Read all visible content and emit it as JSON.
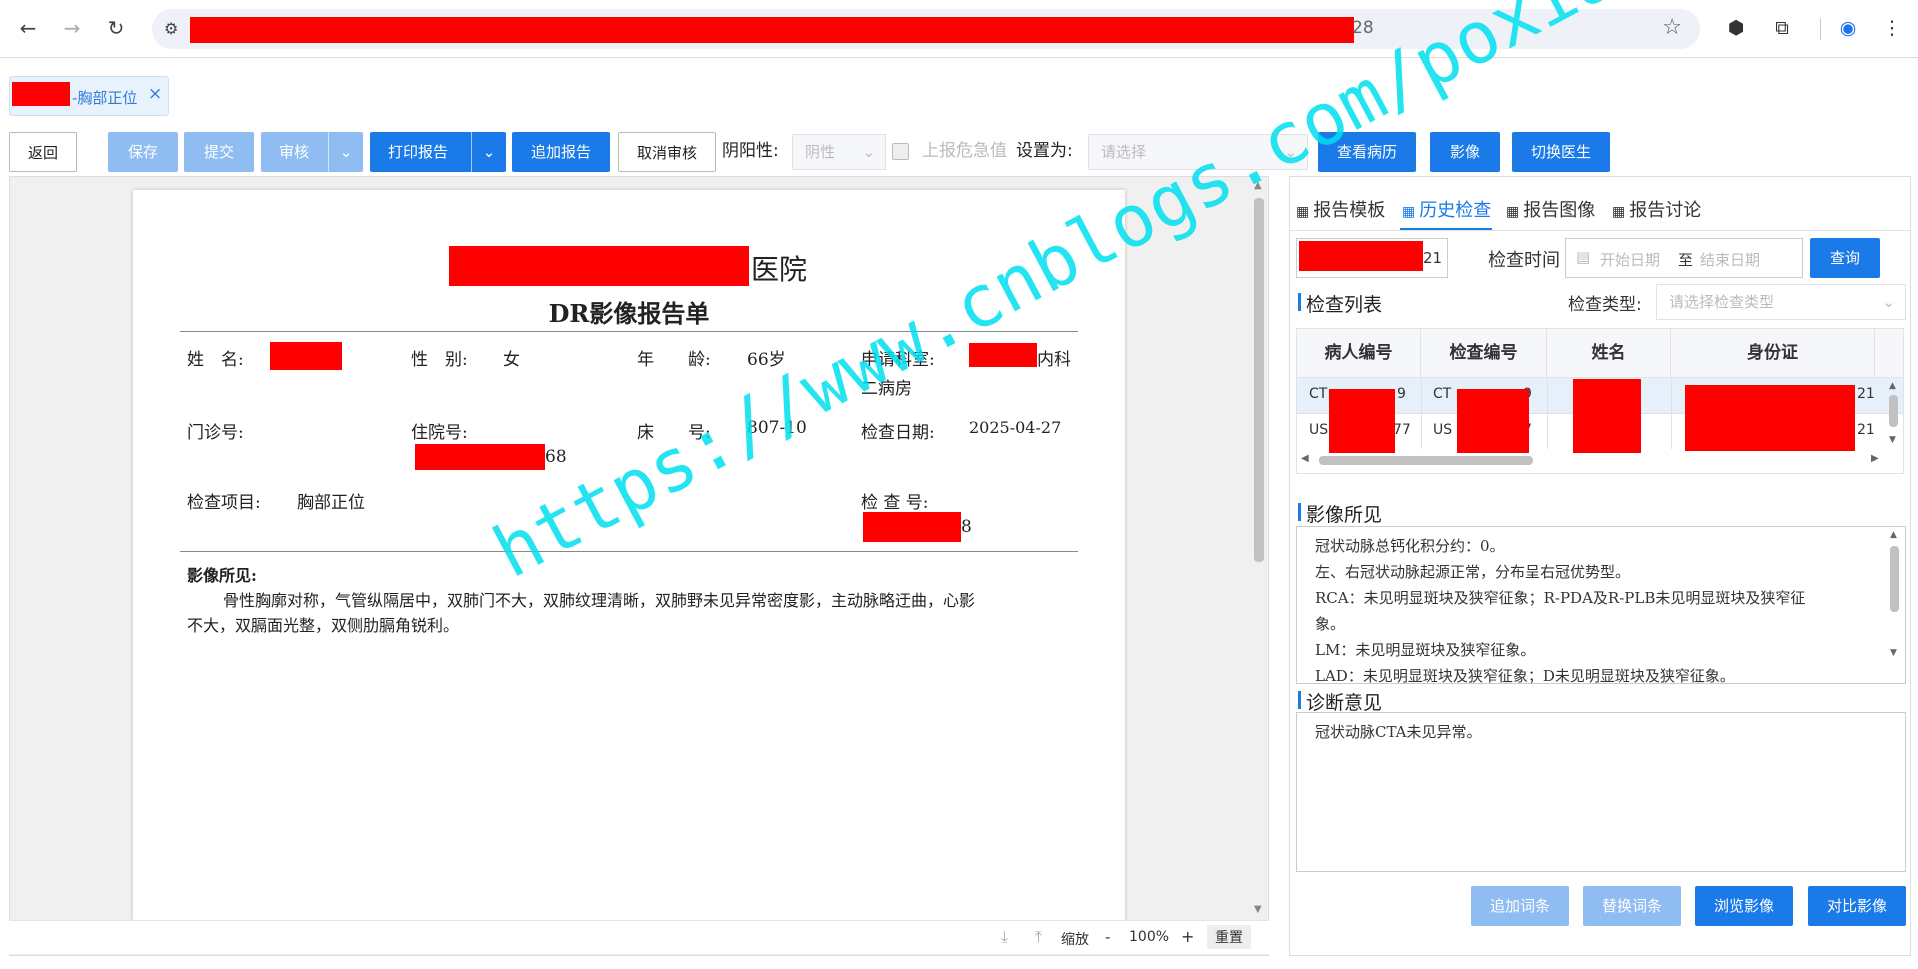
{
  "browser": {
    "url_suffix": "28",
    "icons": [
      "back-arrow-icon",
      "forward-arrow-icon",
      "reload-icon",
      "site-settings-icon",
      "star-icon",
      "extension-hexagon-icon",
      "puzzle-icon",
      "profile-icon",
      "more-vert-icon"
    ]
  },
  "tab": {
    "label": "-胸部正位",
    "close": "×"
  },
  "toolbar": {
    "back": "返回",
    "save": "保存",
    "submit": "提交",
    "review": "审核",
    "print": "打印报告",
    "append": "追加报告",
    "cancel_review": "取消审核",
    "yinyang_label": "阴阳性:",
    "yinyang_value": "阴性",
    "critical_label": "上报危急值",
    "set_as_label": "设置为:",
    "set_as_placeholder": "请选择",
    "view_record": "查看病历",
    "image": "影像",
    "switch_doctor": "切换医生"
  },
  "report": {
    "hospital_suffix": "医院",
    "title": "DR影像报告单",
    "name_label": "姓　名:",
    "gender_label": "性　别:",
    "gender": "女",
    "age_label": "年　　龄:",
    "age": "66岁",
    "dept_label": "申请科室:",
    "dept_tail": "内科",
    "dept_line2": "二病房",
    "clinic_label": "门诊号:",
    "inpatient_label": "住院号:",
    "inpatient_tail": "68",
    "bed_label": "床　　号:",
    "bed": "807-10",
    "exam_date_label": "检查日期:",
    "exam_date": "2025-04-27",
    "exam_item_label": "检查项目:",
    "exam_item": "胸部正位",
    "exam_no_label": "检 查 号:",
    "exam_no_tail": "8",
    "findings_label": "影像所见:",
    "findings_line1": "骨性胸廓对称，气管纵隔居中，双肺门不大，双肺纹理清晰，双肺野未见异常密度影，主动脉略迂曲，心影",
    "findings_line2": "不大，双膈面光整，双侧肋膈角锐利。"
  },
  "viewer": {
    "zoom_label": "缩放",
    "minus": "-",
    "zoom": "100%",
    "plus": "+",
    "reset": "重置"
  },
  "right": {
    "tabs": [
      "报告模板",
      "历史检查",
      "报告图像",
      "报告讨论"
    ],
    "active_tab": 1,
    "id_tail": "21",
    "time_label": "检查时间",
    "start_placeholder": "开始日期",
    "to": "至",
    "end_placeholder": "结束日期",
    "query": "查询",
    "list_label": "检查列表",
    "type_label": "检查类型:",
    "type_placeholder": "请选择检查类型",
    "columns": [
      "病人编号",
      "检查编号",
      "姓名",
      "身份证"
    ],
    "rows": [
      [
        "CT",
        "9",
        "CT",
        "9",
        "21"
      ],
      [
        "US",
        "77",
        "US",
        "7",
        "21"
      ]
    ],
    "findings_label": "影像所见",
    "findings_lines": [
      "冠状动脉总钙化积分约：0。",
      "左、右冠状动脉起源正常，分布呈右冠优势型。",
      "RCA：未见明显斑块及狭窄征象；R-PDA及R-PLB未见明显斑块及狭窄征",
      "象。",
      "LM：未见明显斑块及狭窄征象。",
      "LAD：未见明显斑块及狭窄征象；D未见明显斑块及狭窄征象。"
    ],
    "diagnosis_label": "诊断意见",
    "diagnosis": "冠状动脉CTA未见异常。",
    "btn_add_phrase": "追加词条",
    "btn_replace_phrase": "替换词条",
    "btn_browse": "浏览影像",
    "btn_compare": "对比影像"
  },
  "watermark": "https://www.cnblogs.com/poxiao"
}
